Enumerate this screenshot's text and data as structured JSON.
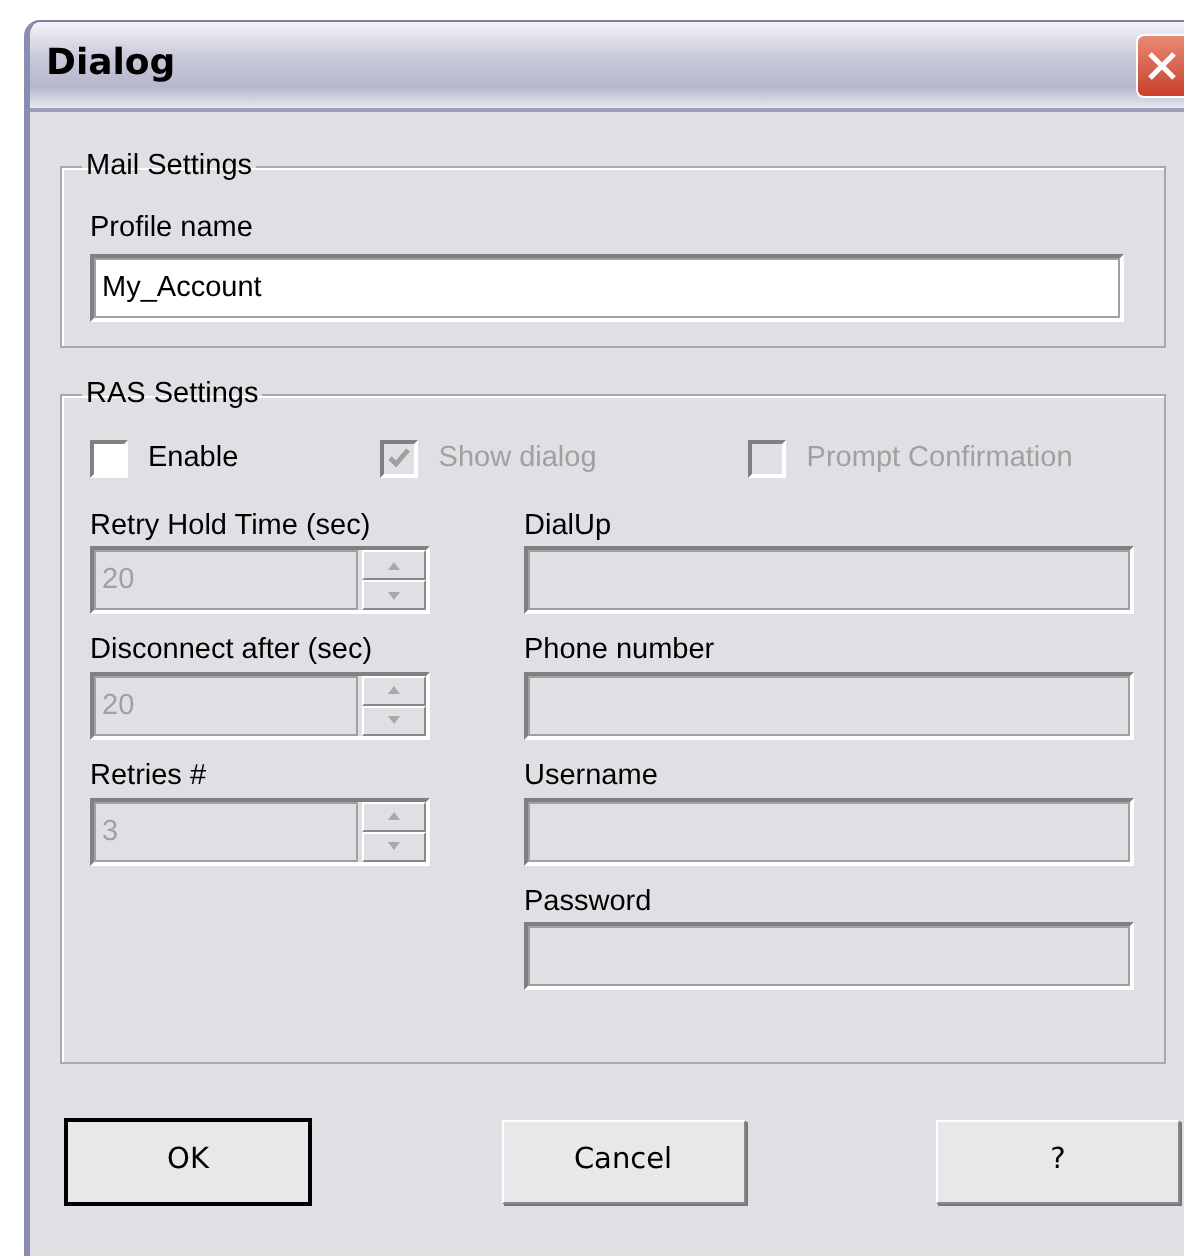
{
  "window": {
    "title": "Dialog"
  },
  "mail_settings": {
    "legend": "Mail Settings",
    "profile_name": {
      "label": "Profile name",
      "value": "My_Account"
    }
  },
  "ras_settings": {
    "legend": "RAS Settings",
    "checkboxes": [
      {
        "label": "Enable",
        "checked": false,
        "disabled": false
      },
      {
        "label": "Show dialog",
        "checked": true,
        "disabled": true
      },
      {
        "label": "Prompt Confirmation",
        "checked": false,
        "disabled": true
      }
    ],
    "spinners": [
      {
        "label": "Retry Hold Time (sec)",
        "value": "20",
        "disabled": true
      },
      {
        "label": "Disconnect after (sec)",
        "value": "20",
        "disabled": true
      },
      {
        "label": "Retries #",
        "value": "3",
        "disabled": true
      }
    ],
    "fields": [
      {
        "label": "DialUp",
        "disabled": true
      },
      {
        "label": "Phone number",
        "disabled": true
      },
      {
        "label": "Username",
        "disabled": true
      },
      {
        "label": "Password",
        "disabled": true
      }
    ]
  },
  "buttons": [
    {
      "label": "OK",
      "default": true
    },
    {
      "label": "Cancel",
      "default": false
    },
    {
      "label": "?",
      "default": false
    }
  ]
}
